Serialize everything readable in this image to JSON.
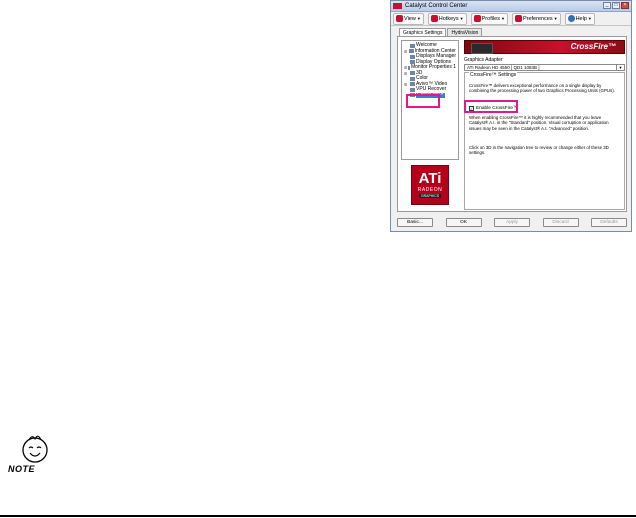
{
  "window": {
    "title": "Catalyst Control Center",
    "controls": [
      "_",
      "□",
      "×"
    ],
    "toolbar": [
      {
        "label": "View",
        "icon": "ati-icon"
      },
      {
        "label": "Hotkeys",
        "icon": "ati-icon"
      },
      {
        "label": "Profiles",
        "icon": "ati-icon"
      },
      {
        "label": "Preferences",
        "icon": "ati-icon"
      },
      {
        "label": "Help",
        "icon": "help-icon"
      }
    ],
    "tabs": [
      "Graphics Settings",
      "HydraVision"
    ],
    "tree": [
      {
        "label": "Welcome",
        "exp": ""
      },
      {
        "label": "Information Center",
        "exp": "⊞"
      },
      {
        "label": "Displays Manager",
        "exp": ""
      },
      {
        "label": "Display Options",
        "exp": ""
      },
      {
        "label": "Monitor Properties 1",
        "exp": "⊞"
      },
      {
        "label": "3D",
        "exp": "⊞"
      },
      {
        "label": "Color",
        "exp": ""
      },
      {
        "label": "Avivo™ Video",
        "exp": "⊞"
      },
      {
        "label": "VPU Recover",
        "exp": ""
      },
      {
        "label": "CrossFire™",
        "exp": ""
      }
    ],
    "logo": {
      "brand": "ATi",
      "line": "RADEON",
      "sub": "GRAPHICS"
    },
    "banner_title": "CrossFire™",
    "adapter_label": "Graphics Adapter",
    "adapter_value": "ATI Radeon HD 4550 [ QD1 1084B ]",
    "settings_title": "CrossFire™ Settings",
    "desc1": "CrossFire™ delivers exceptional performance on a single display by combining the processing power of two Graphics Processing Units (GPUs).",
    "checkbox_label": "Enable CrossFire™",
    "desc2": "When enabling CrossFire™ it is highly recommended that you leave Catalyst® A.I. in the \"Standard\" position. Visual corruption or application issues may be seen in the Catalyst® A.I. \"Advanced\" position.",
    "desc3": "Click on 3D in the navigation tree to review or change either of these 3D settings.",
    "buttons": [
      "Basic...",
      "OK",
      "Apply",
      "Discard",
      "Defaults"
    ]
  },
  "note_label": "NOTE",
  "colors": {
    "highlight": "#e2198a",
    "ati_red": "#c8102e"
  }
}
